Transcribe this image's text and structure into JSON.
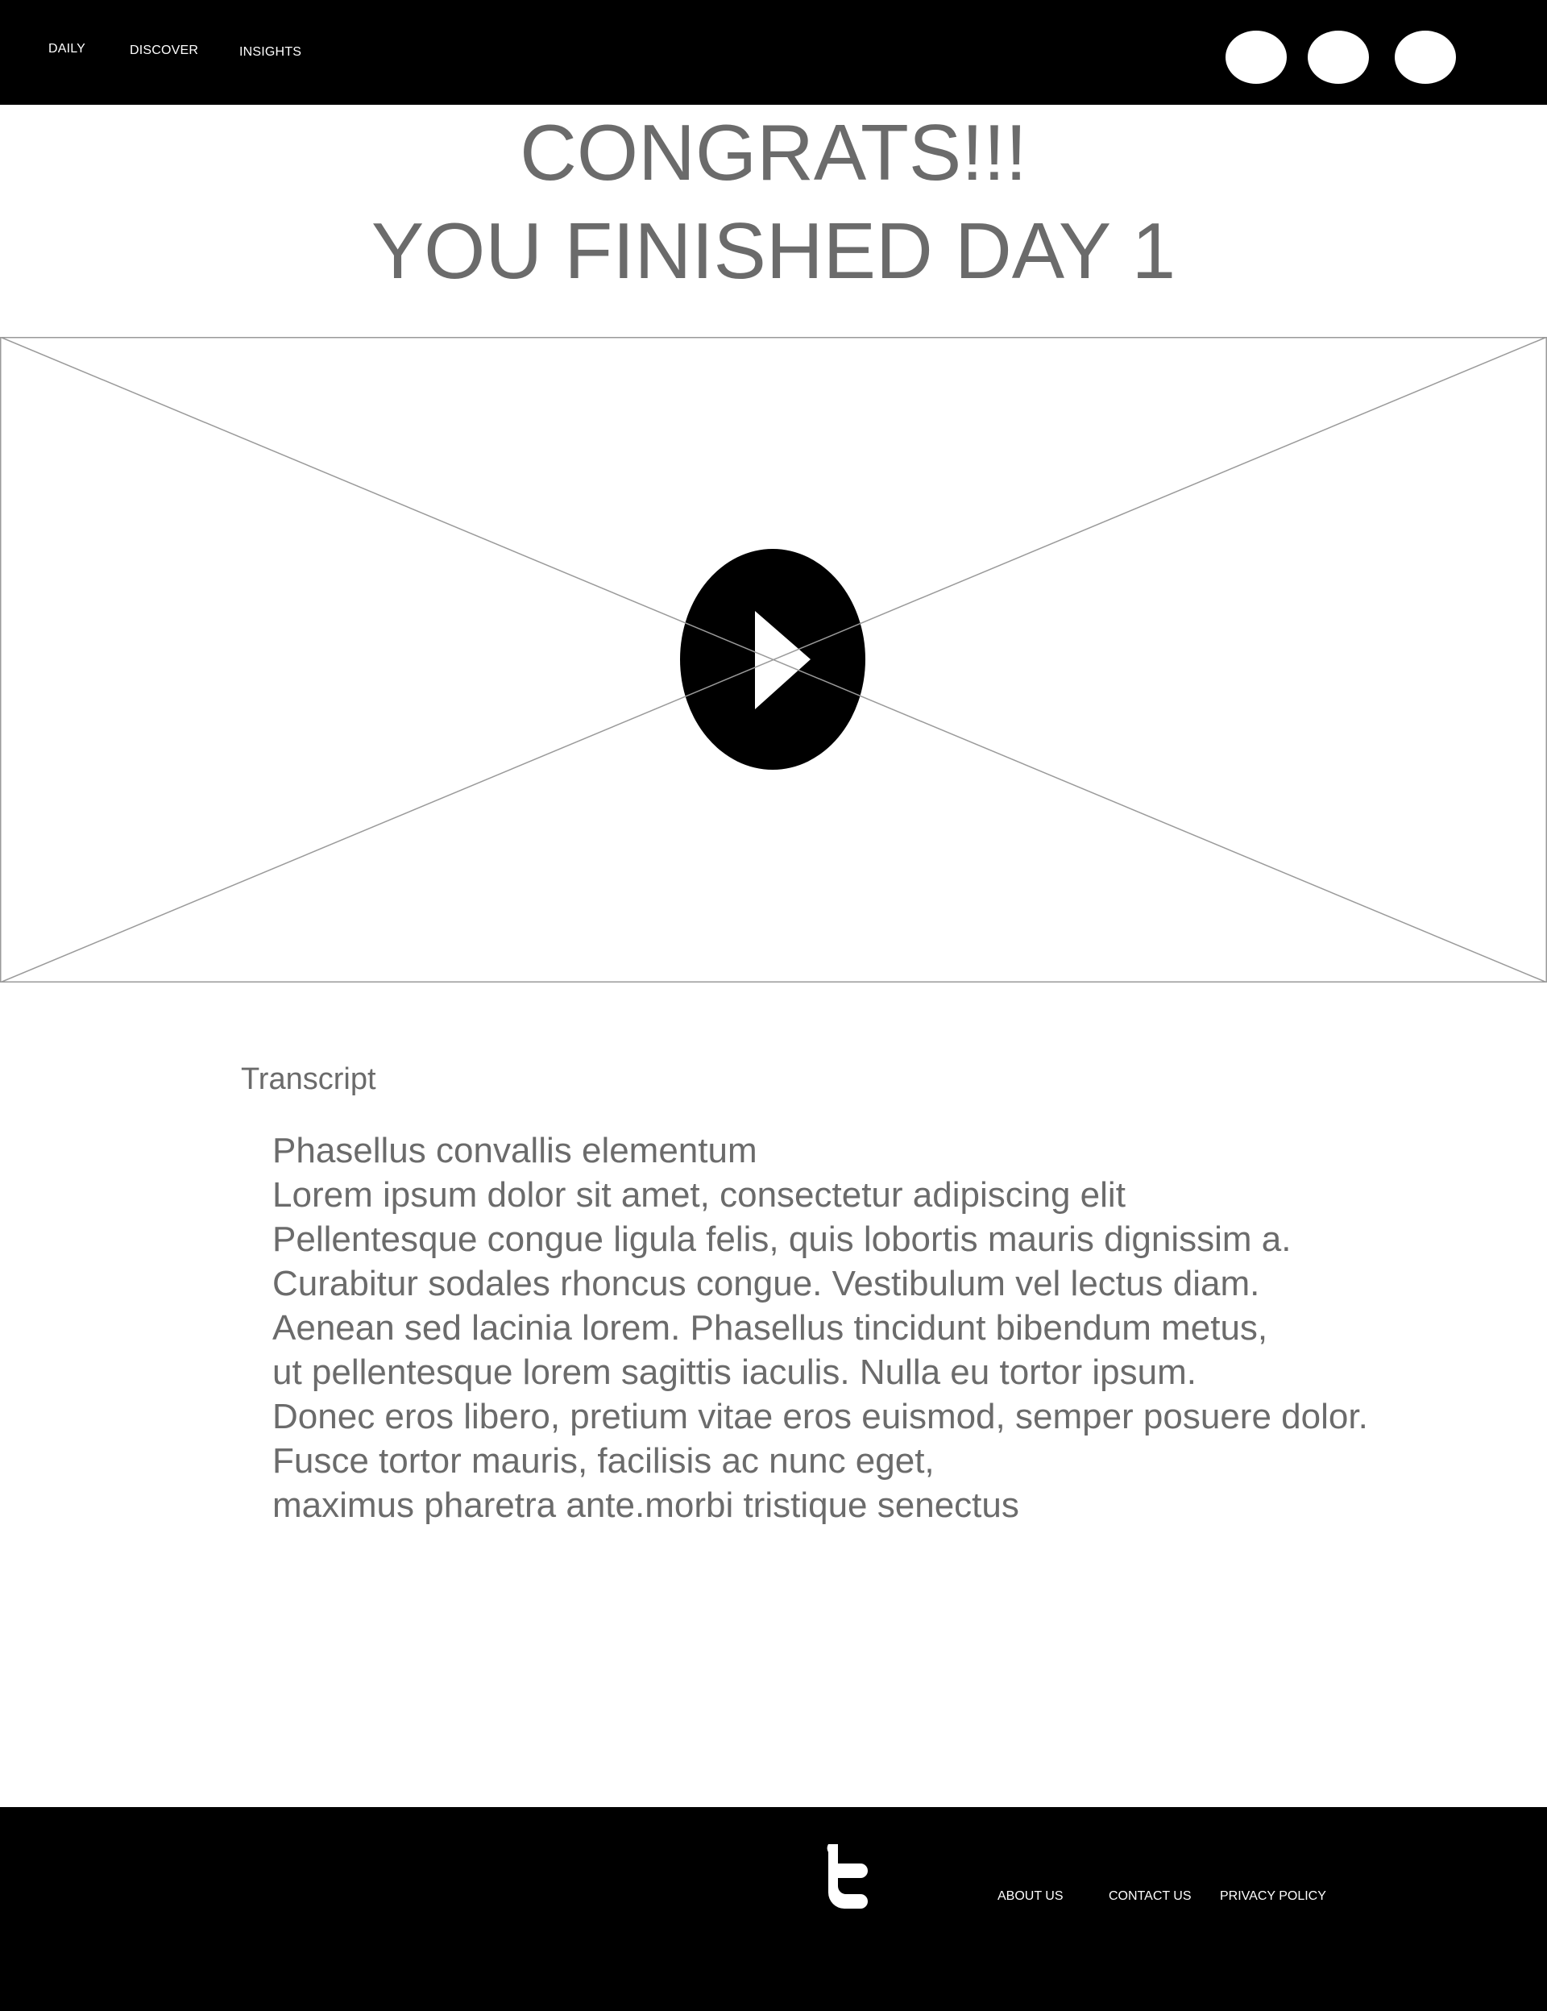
{
  "header": {
    "nav": {
      "daily": "DAILY",
      "discover": "DISCOVER",
      "insights": "INSIGHTS"
    }
  },
  "main": {
    "headline_line1": "CONGRATS!!!",
    "headline_line2": "YOU FINISHED DAY 1",
    "video": {
      "play_icon": "play-icon"
    },
    "transcript": {
      "label": "Transcript",
      "lines": [
        "Phasellus convallis elementum",
        "Lorem ipsum dolor sit amet, consectetur adipiscing elit",
        "Pellentesque congue ligula felis, quis lobortis mauris dignissim a.",
        "Curabitur sodales rhoncus congue. Vestibulum vel lectus diam.",
        "Aenean sed lacinia lorem. Phasellus tincidunt bibendum metus,",
        "ut pellentesque lorem sagittis iaculis. Nulla eu tortor ipsum.",
        "Donec eros libero, pretium vitae eros euismod, semper posuere dolor.",
        "Fusce tortor mauris, facilisis ac nunc eget,",
        "maximus pharetra ante.morbi tristique senectus"
      ]
    }
  },
  "footer": {
    "social_icon": "twitter-icon",
    "links": {
      "about": "ABOUT US",
      "contact": "CONTACT US",
      "privacy": "PRIVACY POLICY"
    }
  },
  "colors": {
    "bar_background": "#000000",
    "text_gray": "#6b6b6b",
    "placeholder_line": "#9a9a9a"
  }
}
